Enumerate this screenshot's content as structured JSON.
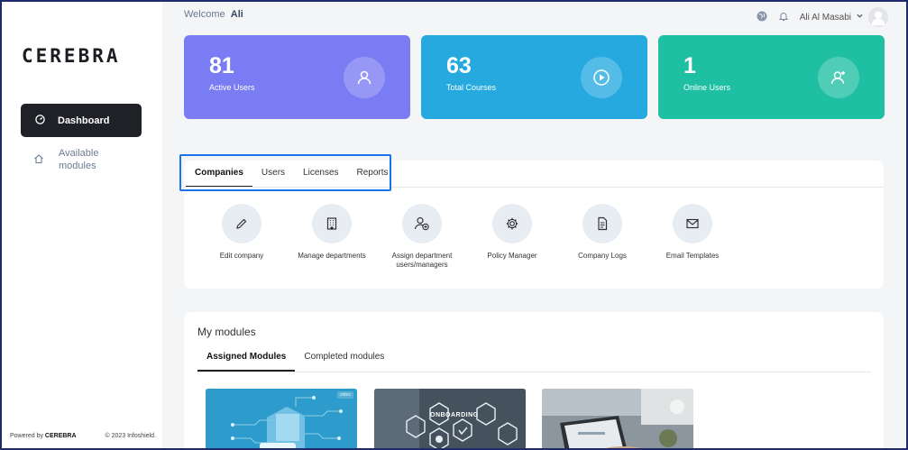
{
  "sidebar": {
    "logo": "CEREBRA",
    "items": [
      {
        "label": "Dashboard",
        "icon": "gauge-icon",
        "active": true
      },
      {
        "label": "Available modules",
        "icon": "home-icon",
        "active": false
      }
    ],
    "footer": {
      "powered_prefix": "Powered by",
      "powered_brand": "CEREBRA",
      "copyright": "© 2023 Infoshield."
    }
  },
  "header": {
    "welcome_prefix": "Welcome",
    "welcome_name": "Ali",
    "user_name": "Ali Al Masabi",
    "icons": [
      "globe-icon",
      "bell-icon",
      "chevron-down-icon",
      "avatar"
    ]
  },
  "stats": [
    {
      "value": "81",
      "label": "Active Users",
      "color": "#7a7cf3",
      "icon": "user-icon"
    },
    {
      "value": "63",
      "label": "Total Courses",
      "color": "#25a9df",
      "icon": "play-icon"
    },
    {
      "value": "1",
      "label": "Online Users",
      "color": "#1fbfa3",
      "icon": "user-plus-icon"
    }
  ],
  "tabs": [
    {
      "label": "Companies",
      "active": true
    },
    {
      "label": "Users",
      "active": false
    },
    {
      "label": "Licenses",
      "active": false
    },
    {
      "label": "Reports",
      "active": false
    }
  ],
  "actions": [
    {
      "label": "Edit company",
      "icon": "pencil-icon"
    },
    {
      "label": "Manage departments",
      "icon": "building-icon"
    },
    {
      "label": "Assign department users/managers",
      "icon": "user-add-icon"
    },
    {
      "label": "Policy Manager",
      "icon": "gear-icon"
    },
    {
      "label": "Company Logs",
      "icon": "document-icon"
    },
    {
      "label": "Email Templates",
      "icon": "mail-icon"
    }
  ],
  "modules": {
    "title": "My modules",
    "tabs": [
      {
        "label": "Assigned Modules",
        "active": true
      },
      {
        "label": "Completed modules",
        "active": false
      }
    ],
    "thumbnails": [
      {
        "badge": "video",
        "overlay_text": ""
      },
      {
        "badge": "",
        "overlay_text": "ONBOARDING"
      },
      {
        "badge": "",
        "overlay_text": ""
      }
    ]
  },
  "colors": {
    "highlight": "#1a73e8",
    "sidebar_active": "#1f2126"
  }
}
